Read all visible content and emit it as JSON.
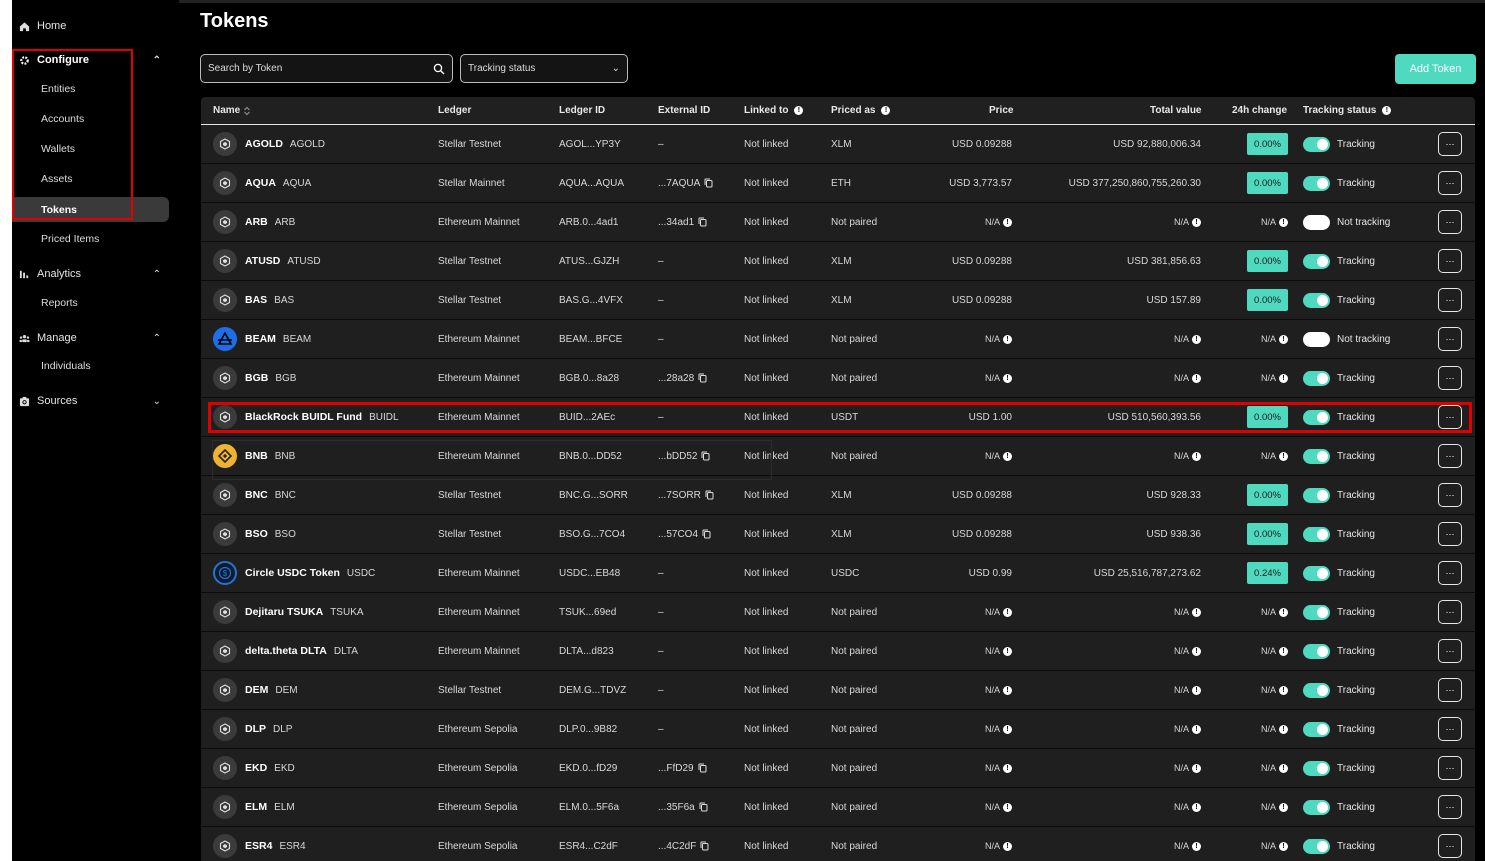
{
  "sidebar": {
    "home": "Home",
    "configure": {
      "label": "Configure",
      "items": [
        "Entities",
        "Accounts",
        "Wallets",
        "Assets",
        "Tokens",
        "Priced Items"
      ],
      "active": "Tokens"
    },
    "analytics": {
      "label": "Analytics",
      "items": [
        "Reports"
      ]
    },
    "manage": {
      "label": "Manage",
      "items": [
        "Individuals"
      ]
    },
    "sources": {
      "label": "Sources"
    }
  },
  "page": {
    "title": "Tokens",
    "search_placeholder": "Search by Token",
    "tracking_filter": "Tracking status",
    "add_button": "Add Token"
  },
  "table": {
    "columns": {
      "name": "Name",
      "ledger": "Ledger",
      "ledger_id": "Ledger ID",
      "external_id": "External ID",
      "linked_to": "Linked to",
      "priced_as": "Priced as",
      "price": "Price",
      "total_value": "Total value",
      "change_24h": "24h change",
      "tracking_status": "Tracking status"
    },
    "rows": [
      {
        "name": "AGOLD",
        "symbol": "AGOLD",
        "icon": "generic",
        "ledger": "Stellar Testnet",
        "ledger_id": "AGOL...YP3Y",
        "external_id": "–",
        "copy": false,
        "linked": "Not linked",
        "priced_as": "XLM",
        "price": "USD  0.09288",
        "total": "USD  92,880,006.34",
        "change": "0.00%",
        "tracking": true,
        "tracking_label": "Tracking"
      },
      {
        "name": "AQUA",
        "symbol": "AQUA",
        "icon": "generic",
        "ledger": "Stellar Mainnet",
        "ledger_id": "AQUA...AQUA",
        "external_id": "...7AQUA",
        "copy": true,
        "linked": "Not linked",
        "priced_as": "ETH",
        "price": "USD  3,773.57",
        "total": "USD  377,250,860,755,260.30",
        "change": "0.00%",
        "tracking": true,
        "tracking_label": "Tracking"
      },
      {
        "name": "ARB",
        "symbol": "ARB",
        "icon": "generic",
        "ledger": "Ethereum Mainnet",
        "ledger_id": "ARB.0...4ad1",
        "external_id": "...34ad1",
        "copy": true,
        "linked": "Not linked",
        "priced_as": "Not paired",
        "price": null,
        "total": null,
        "change": null,
        "tracking": false,
        "tracking_label": "Not tracking"
      },
      {
        "name": "ATUSD",
        "symbol": "ATUSD",
        "icon": "generic",
        "ledger": "Stellar Testnet",
        "ledger_id": "ATUS...GJZH",
        "external_id": "–",
        "copy": false,
        "linked": "Not linked",
        "priced_as": "XLM",
        "price": "USD  0.09288",
        "total": "USD  381,856.63",
        "change": "0.00%",
        "tracking": true,
        "tracking_label": "Tracking"
      },
      {
        "name": "BAS",
        "symbol": "BAS",
        "icon": "generic",
        "ledger": "Stellar Testnet",
        "ledger_id": "BAS.G...4VFX",
        "external_id": "–",
        "copy": false,
        "linked": "Not linked",
        "priced_as": "XLM",
        "price": "USD  0.09288",
        "total": "USD  157.89",
        "change": "0.00%",
        "tracking": true,
        "tracking_label": "Tracking"
      },
      {
        "name": "BEAM",
        "symbol": "BEAM",
        "icon": "beam",
        "ledger": "Ethereum Mainnet",
        "ledger_id": "BEAM...BFCE",
        "external_id": "–",
        "copy": false,
        "linked": "Not linked",
        "priced_as": "Not paired",
        "price": null,
        "total": null,
        "change": null,
        "tracking": false,
        "tracking_label": "Not tracking"
      },
      {
        "name": "BGB",
        "symbol": "BGB",
        "icon": "generic",
        "ledger": "Ethereum Mainnet",
        "ledger_id": "BGB.0...8a28",
        "external_id": "...28a28",
        "copy": true,
        "linked": "Not linked",
        "priced_as": "Not paired",
        "price": null,
        "total": null,
        "change": null,
        "tracking": true,
        "tracking_label": "Tracking"
      },
      {
        "name": "BlackRock BUIDL Fund",
        "symbol": "BUIDL",
        "icon": "generic",
        "ledger": "Ethereum Mainnet",
        "ledger_id": "BUID...2AEc",
        "external_id": "–",
        "copy": false,
        "linked": "Not linked",
        "priced_as": "USDT",
        "price": "USD  1.00",
        "total": "USD  510,560,393.56",
        "change": "0.00%",
        "tracking": true,
        "tracking_label": "Tracking"
      },
      {
        "name": "BNB",
        "symbol": "BNB",
        "icon": "bnb",
        "ledger": "Ethereum Mainnet",
        "ledger_id": "BNB.0...DD52",
        "external_id": "...bDD52",
        "copy": true,
        "linked": "Not linked",
        "priced_as": "Not paired",
        "price": null,
        "total": null,
        "change": null,
        "tracking": true,
        "tracking_label": "Tracking"
      },
      {
        "name": "BNC",
        "symbol": "BNC",
        "icon": "generic",
        "ledger": "Stellar Testnet",
        "ledger_id": "BNC.G...SORR",
        "external_id": "...7SORR",
        "copy": true,
        "linked": "Not linked",
        "priced_as": "XLM",
        "price": "USD  0.09288",
        "total": "USD  928.33",
        "change": "0.00%",
        "tracking": true,
        "tracking_label": "Tracking"
      },
      {
        "name": "BSO",
        "symbol": "BSO",
        "icon": "generic",
        "ledger": "Stellar Testnet",
        "ledger_id": "BSO.G...7CO4",
        "external_id": "...57CO4",
        "copy": true,
        "linked": "Not linked",
        "priced_as": "XLM",
        "price": "USD  0.09288",
        "total": "USD  938.36",
        "change": "0.00%",
        "tracking": true,
        "tracking_label": "Tracking"
      },
      {
        "name": "Circle USDC Token",
        "symbol": "USDC",
        "icon": "usdc",
        "ledger": "Ethereum Mainnet",
        "ledger_id": "USDC...EB48",
        "external_id": "–",
        "copy": false,
        "linked": "Not linked",
        "priced_as": "USDC",
        "price": "USD  0.99",
        "total": "USD  25,516,787,273.62",
        "change": "0.24%",
        "tracking": true,
        "tracking_label": "Tracking"
      },
      {
        "name": "Dejitaru TSUKA",
        "symbol": "TSUKA",
        "icon": "generic",
        "ledger": "Ethereum Mainnet",
        "ledger_id": "TSUK...69ed",
        "external_id": "–",
        "copy": false,
        "linked": "Not linked",
        "priced_as": "Not paired",
        "price": null,
        "total": null,
        "change": null,
        "tracking": true,
        "tracking_label": "Tracking"
      },
      {
        "name": "delta.theta DLTA",
        "symbol": "DLTA",
        "icon": "generic",
        "ledger": "Ethereum Mainnet",
        "ledger_id": "DLTA...d823",
        "external_id": "–",
        "copy": false,
        "linked": "Not linked",
        "priced_as": "Not paired",
        "price": null,
        "total": null,
        "change": null,
        "tracking": true,
        "tracking_label": "Tracking"
      },
      {
        "name": "DEM",
        "symbol": "DEM",
        "icon": "generic",
        "ledger": "Stellar Testnet",
        "ledger_id": "DEM.G...TDVZ",
        "external_id": "–",
        "copy": false,
        "linked": "Not linked",
        "priced_as": "Not paired",
        "price": null,
        "total": null,
        "change": null,
        "tracking": true,
        "tracking_label": "Tracking"
      },
      {
        "name": "DLP",
        "symbol": "DLP",
        "icon": "generic",
        "ledger": "Ethereum Sepolia",
        "ledger_id": "DLP.0...9B82",
        "external_id": "–",
        "copy": false,
        "linked": "Not linked",
        "priced_as": "Not paired",
        "price": null,
        "total": null,
        "change": null,
        "tracking": true,
        "tracking_label": "Tracking"
      },
      {
        "name": "EKD",
        "symbol": "EKD",
        "icon": "generic",
        "ledger": "Ethereum Sepolia",
        "ledger_id": "EKD.0...fD29",
        "external_id": "...FfD29",
        "copy": true,
        "linked": "Not linked",
        "priced_as": "Not paired",
        "price": null,
        "total": null,
        "change": null,
        "tracking": true,
        "tracking_label": "Tracking"
      },
      {
        "name": "ELM",
        "symbol": "ELM",
        "icon": "generic",
        "ledger": "Ethereum Sepolia",
        "ledger_id": "ELM.0...5F6a",
        "external_id": "...35F6a",
        "copy": true,
        "linked": "Not linked",
        "priced_as": "Not paired",
        "price": null,
        "total": null,
        "change": null,
        "tracking": true,
        "tracking_label": "Tracking"
      },
      {
        "name": "ESR4",
        "symbol": "ESR4",
        "icon": "generic",
        "ledger": "Ethereum Sepolia",
        "ledger_id": "ESR4...C2dF",
        "external_id": "...4C2dF",
        "copy": true,
        "linked": "Not linked",
        "priced_as": "Not paired",
        "price": null,
        "total": null,
        "change": null,
        "tracking": true,
        "tracking_label": "Tracking"
      }
    ],
    "na_label": "N/A"
  },
  "colors": {
    "accent": "#4fd9bf",
    "highlight": "#e00000",
    "row_bg": "#1f1f1f",
    "beam_icon": "#1e6ee8",
    "bnb_icon": "#f0b232",
    "usdc_icon": "#2775ca"
  }
}
